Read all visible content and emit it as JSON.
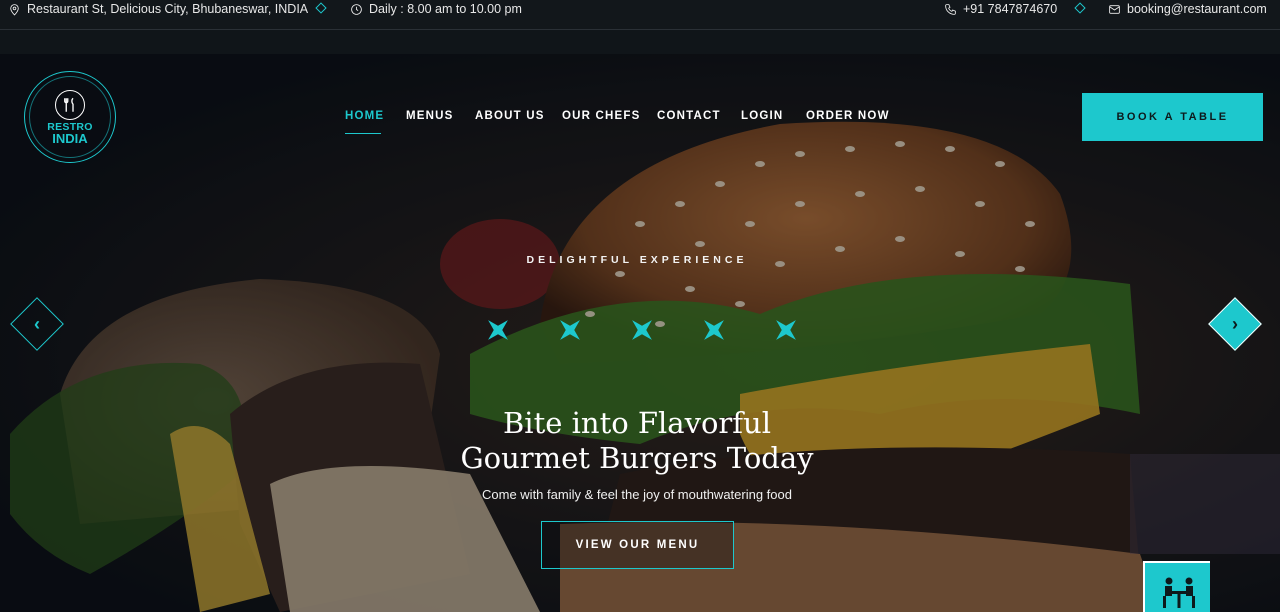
{
  "topbar": {
    "address": "Restaurant St, Delicious City, Bhubaneswar, INDIA",
    "hours": "Daily : 8.00 am to 10.00 pm",
    "phone": "+91 7847874670",
    "email": "booking@restaurant.com"
  },
  "logo": {
    "line1": "RESTRO",
    "line2": "INDIA"
  },
  "nav": {
    "items": [
      {
        "label": "HOME"
      },
      {
        "label": "MENUS"
      },
      {
        "label": "ABOUT US"
      },
      {
        "label": "OUR CHEFS"
      },
      {
        "label": "CONTACT"
      },
      {
        "label": "LOGIN"
      },
      {
        "label": "ORDER NOW"
      }
    ],
    "active": "HOME"
  },
  "book_button": "BOOK A TABLE",
  "hero": {
    "eyebrow": "DELIGHTFUL EXPERIENCE",
    "title_line1": "Bite into Flavorful",
    "title_line2": "Gourmet Burgers Today",
    "subtitle": "Come with family & feel the joy of mouthwatering food",
    "cta": "VIEW OUR MENU",
    "prev_icon": "chevron-left-icon",
    "next_icon": "chevron-right-icon"
  },
  "colors": {
    "accent": "#1dc8cd",
    "topbar_bg": "#12171b"
  }
}
